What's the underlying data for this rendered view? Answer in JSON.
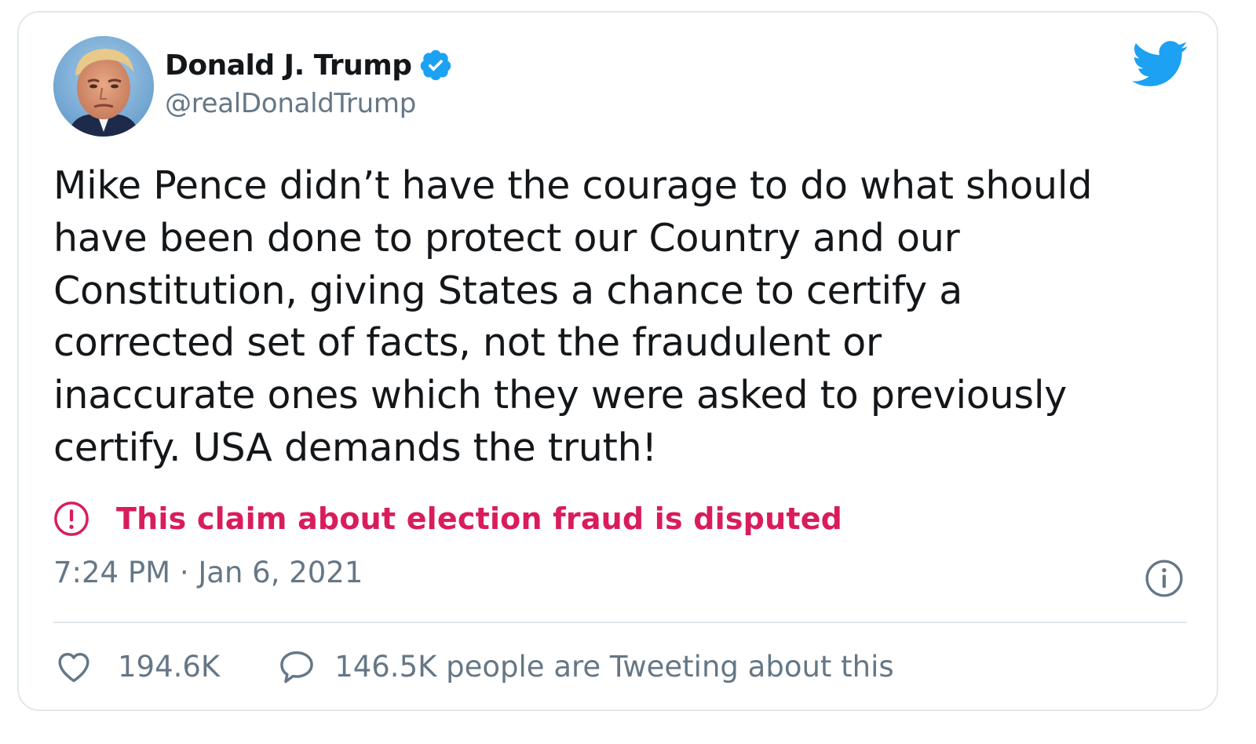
{
  "colors": {
    "text": "#14171a",
    "secondary": "#657786",
    "twitter_blue": "#1da1f2",
    "disputed": "#d91c5c",
    "border": "#e1e8ed"
  },
  "author": {
    "display_name": "Donald J. Trump",
    "handle": "@realDonaldTrump",
    "verified": true,
    "avatar_icon": "profile-photo"
  },
  "brand_icon": "twitter-bird-icon",
  "tweet": {
    "text": "Mike Pence didn’t have the courage to do what should\nhave been done to protect our Country and our\nConstitution, giving States a chance to certify a\ncorrected set of facts, not the fraudulent or\ninaccurate ones which they were asked to previously\ncertify. USA demands the truth!",
    "label": "This claim about election fraud is disputed",
    "label_icon": "exclamation-circle-icon",
    "timestamp": "7:24 PM · Jan 6, 2021",
    "info_icon": "info-icon"
  },
  "engagement": {
    "likes": "194.6K",
    "like_icon": "heart-icon",
    "conversation": "146.5K people are Tweeting about this",
    "conversation_icon": "speech-bubble-icon"
  }
}
